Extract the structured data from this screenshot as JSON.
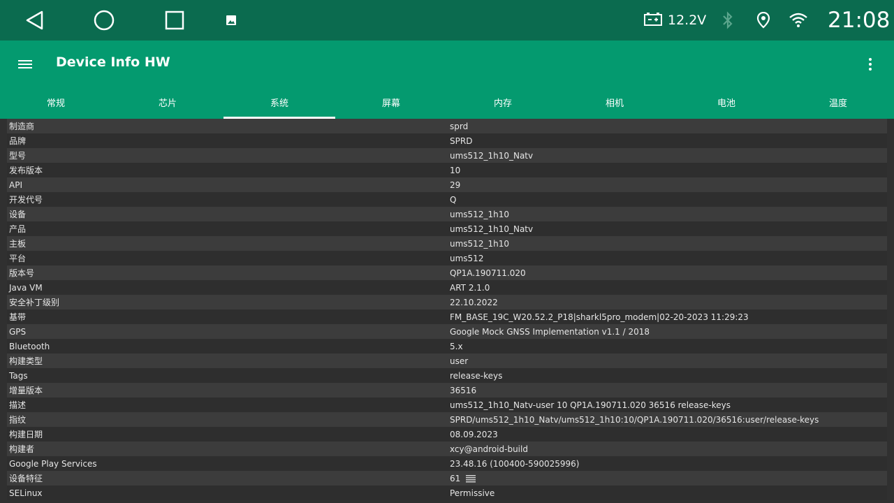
{
  "status_bar": {
    "voltage": "12.2V",
    "time": "21:08",
    "icons": [
      "back-icon",
      "home-icon",
      "recents-icon",
      "image-icon",
      "battery-icon",
      "bluetooth-icon",
      "location-icon",
      "wifi-icon"
    ]
  },
  "app_bar": {
    "title": "Device Info HW",
    "background_color": "#049a6f",
    "status_color": "#0b6b4f"
  },
  "tabs": [
    {
      "label": "常规"
    },
    {
      "label": "芯片"
    },
    {
      "label": "系统",
      "active": true
    },
    {
      "label": "屏幕"
    },
    {
      "label": "内存"
    },
    {
      "label": "相机"
    },
    {
      "label": "电池"
    },
    {
      "label": "温度"
    }
  ],
  "rows": [
    {
      "label": "制造商",
      "value": "sprd"
    },
    {
      "label": "品牌",
      "value": "SPRD"
    },
    {
      "label": "型号",
      "value": "ums512_1h10_Natv"
    },
    {
      "label": "发布版本",
      "value": "10"
    },
    {
      "label": "API",
      "value": "29"
    },
    {
      "label": "开发代号",
      "value": "Q"
    },
    {
      "label": "设备",
      "value": "ums512_1h10"
    },
    {
      "label": "产品",
      "value": "ums512_1h10_Natv"
    },
    {
      "label": "主板",
      "value": "ums512_1h10"
    },
    {
      "label": "平台",
      "value": "ums512"
    },
    {
      "label": "版本号",
      "value": "QP1A.190711.020"
    },
    {
      "label": "Java VM",
      "value": "ART 2.1.0"
    },
    {
      "label": "安全补丁级别",
      "value": "22.10.2022"
    },
    {
      "label": "基带",
      "value": "FM_BASE_19C_W20.52.2_P18|sharkl5pro_modem|02-20-2023 11:29:23"
    },
    {
      "label": "GPS",
      "value": "Google Mock GNSS Implementation v1.1 / 2018"
    },
    {
      "label": "Bluetooth",
      "value": "5.x"
    },
    {
      "label": "构建类型",
      "value": "user"
    },
    {
      "label": "Tags",
      "value": "release-keys"
    },
    {
      "label": "增量版本",
      "value": "36516"
    },
    {
      "label": "描述",
      "value": "ums512_1h10_Natv-user 10 QP1A.190711.020 36516 release-keys"
    },
    {
      "label": "指纹",
      "value": "SPRD/ums512_1h10_Natv/ums512_1h10:10/QP1A.190711.020/36516:user/release-keys"
    },
    {
      "label": "构建日期",
      "value": "08.09.2023"
    },
    {
      "label": "构建者",
      "value": "xcy@android-build"
    },
    {
      "label": "Google Play Services",
      "value": "23.48.16 (100400-590025996)"
    },
    {
      "label": "设备特征",
      "value": " 61",
      "icon": "list-icon"
    },
    {
      "label": "SELinux",
      "value": "Permissive"
    }
  ]
}
